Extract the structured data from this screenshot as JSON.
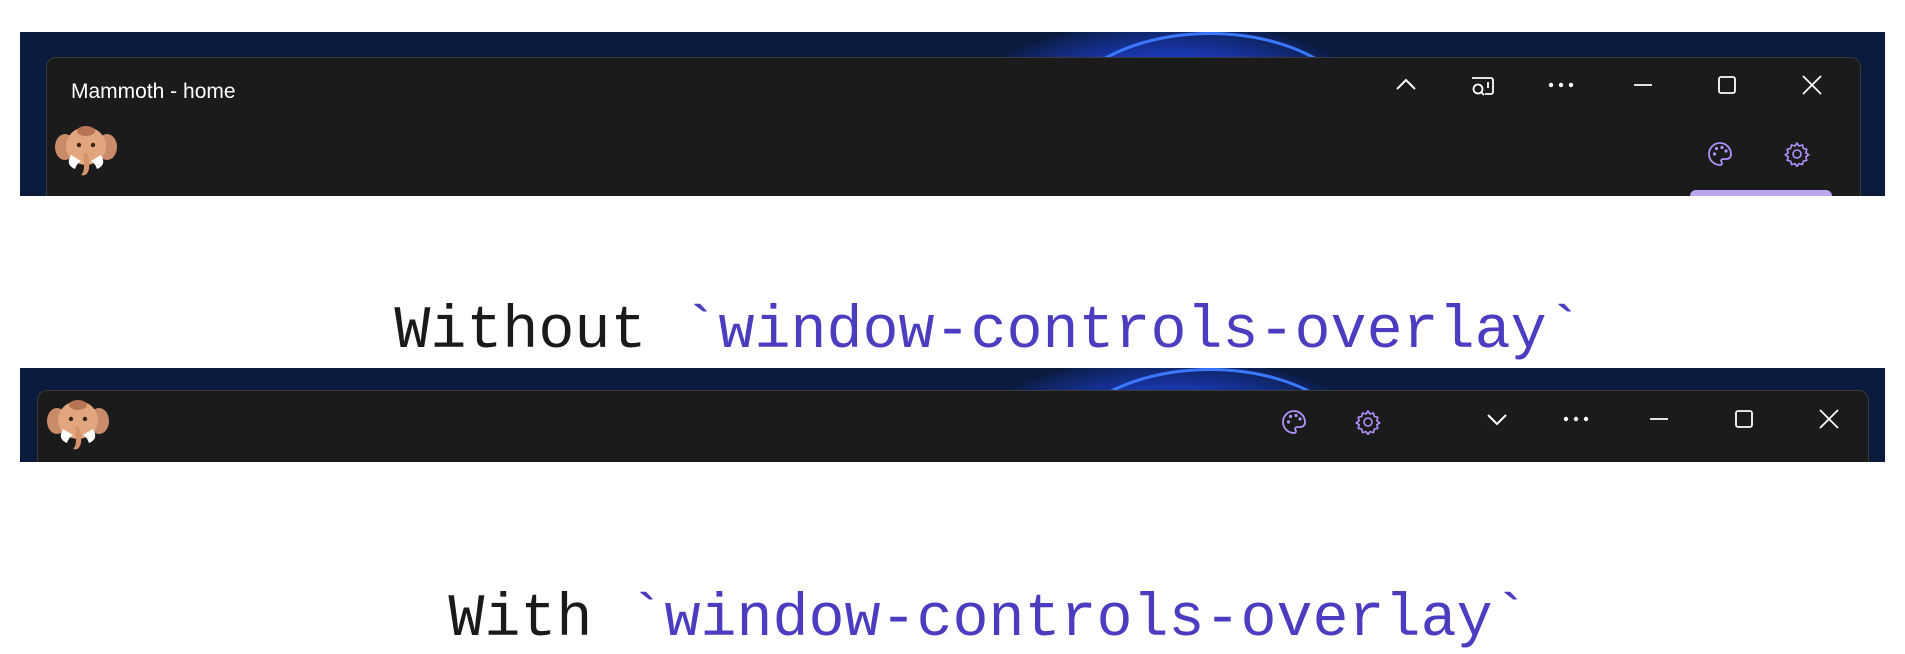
{
  "screenshot_without": {
    "window_title": "Mammoth - home",
    "titlebar_icons": [
      "chevron-up-icon",
      "cast-icon",
      "more-icon",
      "minimize-icon",
      "maximize-icon",
      "close-icon"
    ],
    "toolbar_icons": [
      "palette-icon",
      "gear-icon"
    ],
    "caption": {
      "prefix": "Without ",
      "code": "`window-controls-overlay`"
    }
  },
  "screenshot_with": {
    "toolbar_icons": [
      "palette-icon",
      "gear-icon"
    ],
    "titlebar_icons": [
      "chevron-down-icon",
      "more-icon",
      "minimize-icon",
      "maximize-icon",
      "close-icon"
    ],
    "caption": {
      "prefix": "With ",
      "code": "`window-controls-overlay`"
    }
  },
  "colors": {
    "window_bg": "#1b1b1b",
    "desktop_bg": "#0a1b3d",
    "accent_purple": "#b093ff",
    "code_text": "#4b3cc0"
  }
}
